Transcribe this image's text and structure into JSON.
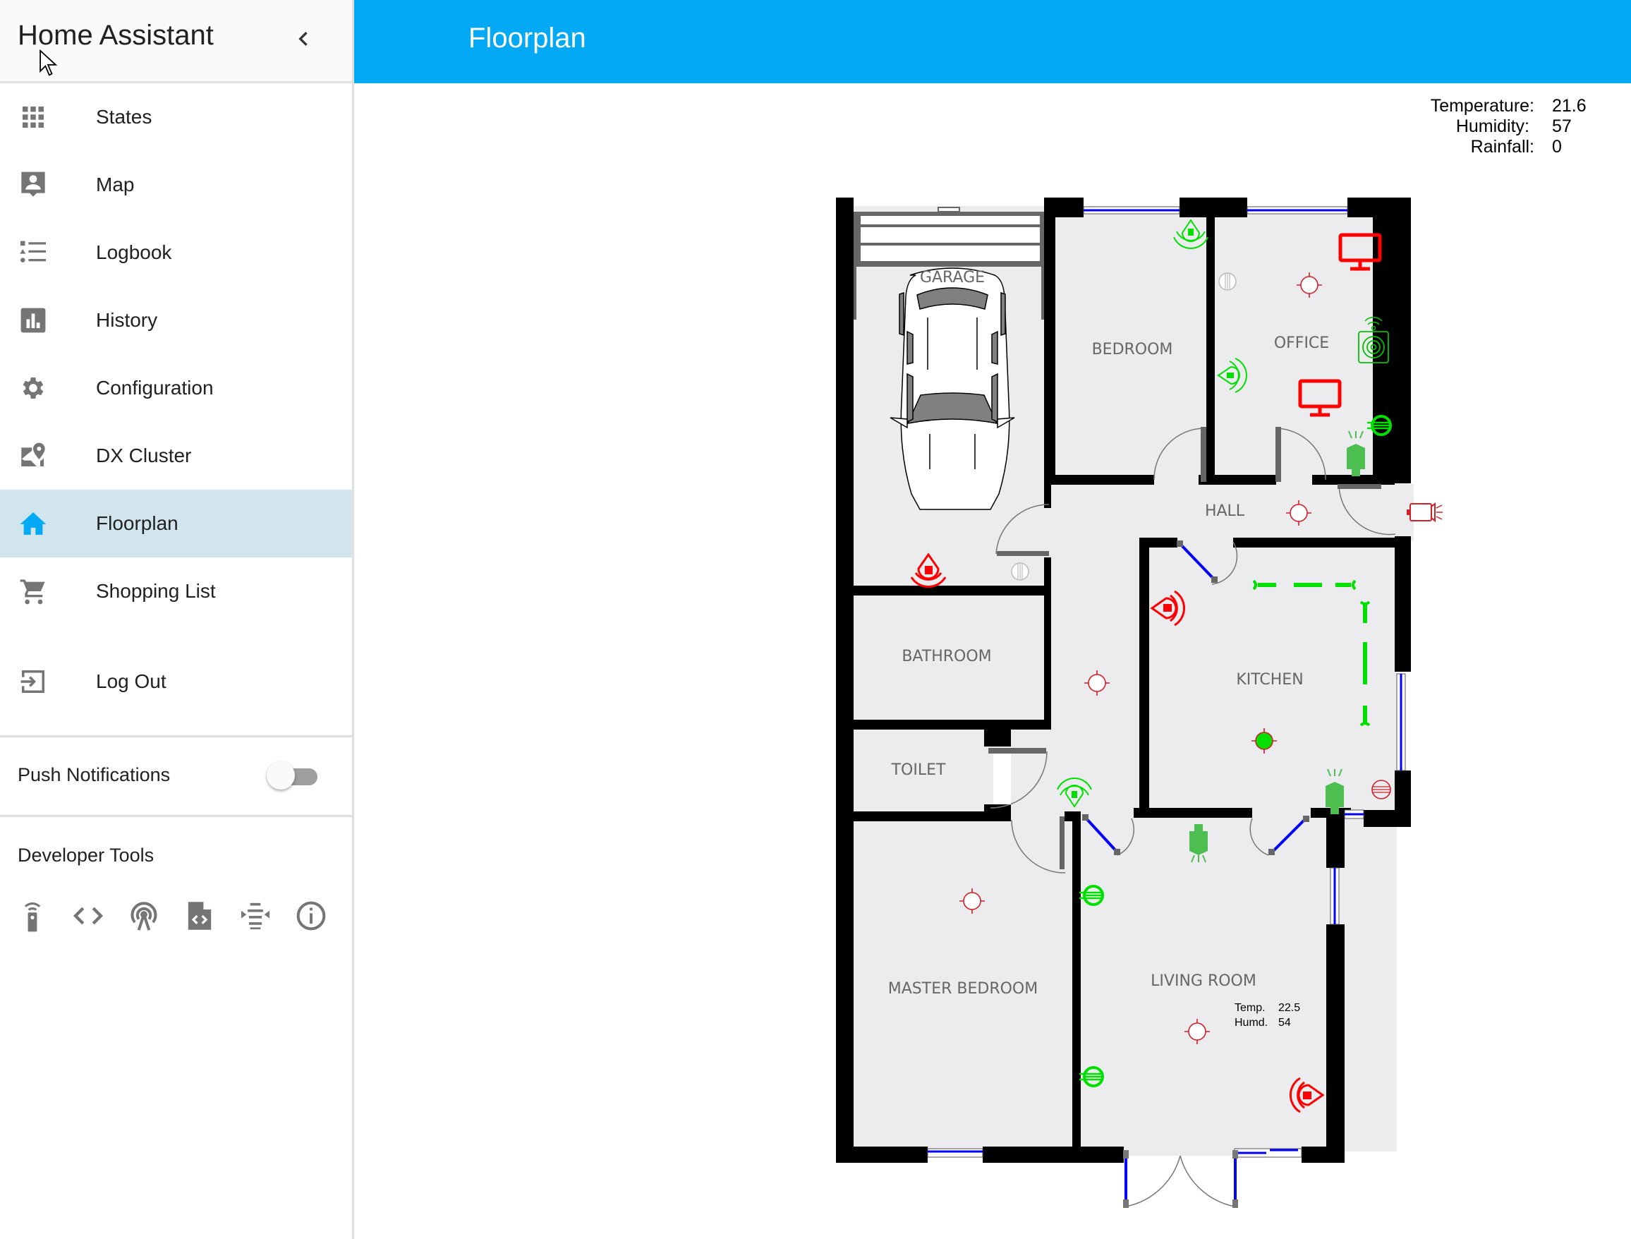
{
  "app": {
    "title": "Home Assistant",
    "collapse_icon": "chevron-left-icon"
  },
  "sidebar": {
    "items": [
      {
        "label": "States",
        "icon": "grid-icon",
        "active": false
      },
      {
        "label": "Map",
        "icon": "account-location-icon",
        "active": false
      },
      {
        "label": "Logbook",
        "icon": "format-list-bulleted-type-icon",
        "active": false
      },
      {
        "label": "History",
        "icon": "chart-box-icon",
        "active": false
      },
      {
        "label": "Configuration",
        "icon": "gear-icon",
        "active": false
      },
      {
        "label": "DX Cluster",
        "icon": "map-marker-radius-icon",
        "active": false
      },
      {
        "label": "Floorplan",
        "icon": "home-icon",
        "active": true
      },
      {
        "label": "Shopping List",
        "icon": "cart-icon",
        "active": false
      }
    ],
    "logout": {
      "label": "Log Out",
      "icon": "logout-icon"
    },
    "push_notifications": {
      "label": "Push Notifications",
      "enabled": false
    },
    "developer_tools": {
      "title": "Developer Tools",
      "icons": [
        "remote-icon",
        "code-tags-icon",
        "access-point-icon",
        "file-xml-icon",
        "format-align-justify-events-icon",
        "info-outline-icon"
      ]
    }
  },
  "header": {
    "title": "Floorplan"
  },
  "weather": {
    "rows": [
      {
        "label": "Temperature:",
        "value": "21.6"
      },
      {
        "label": "Humidity:",
        "value": "57"
      },
      {
        "label": "Rainfall:",
        "value": "0"
      }
    ]
  },
  "floorplan": {
    "rooms": {
      "garage": "GARAGE",
      "bedroom": "BEDROOM",
      "office": "OFFICE",
      "hall": "HALL",
      "bathroom": "BATHROOM",
      "kitchen": "KITCHEN",
      "toilet": "TOILET",
      "master_bedroom": "MASTER BEDROOM",
      "living_room": "LIVING ROOM"
    },
    "living_room_sensor": {
      "temp_label": "Temp.",
      "temp_value": "22.5",
      "humd_label": "Humd.",
      "humd_value": "54"
    },
    "colors": {
      "on": "#00e000",
      "off": "#ff0000",
      "door_open": "#0000ff",
      "wall": "#000000",
      "floor": "#ececee"
    }
  }
}
